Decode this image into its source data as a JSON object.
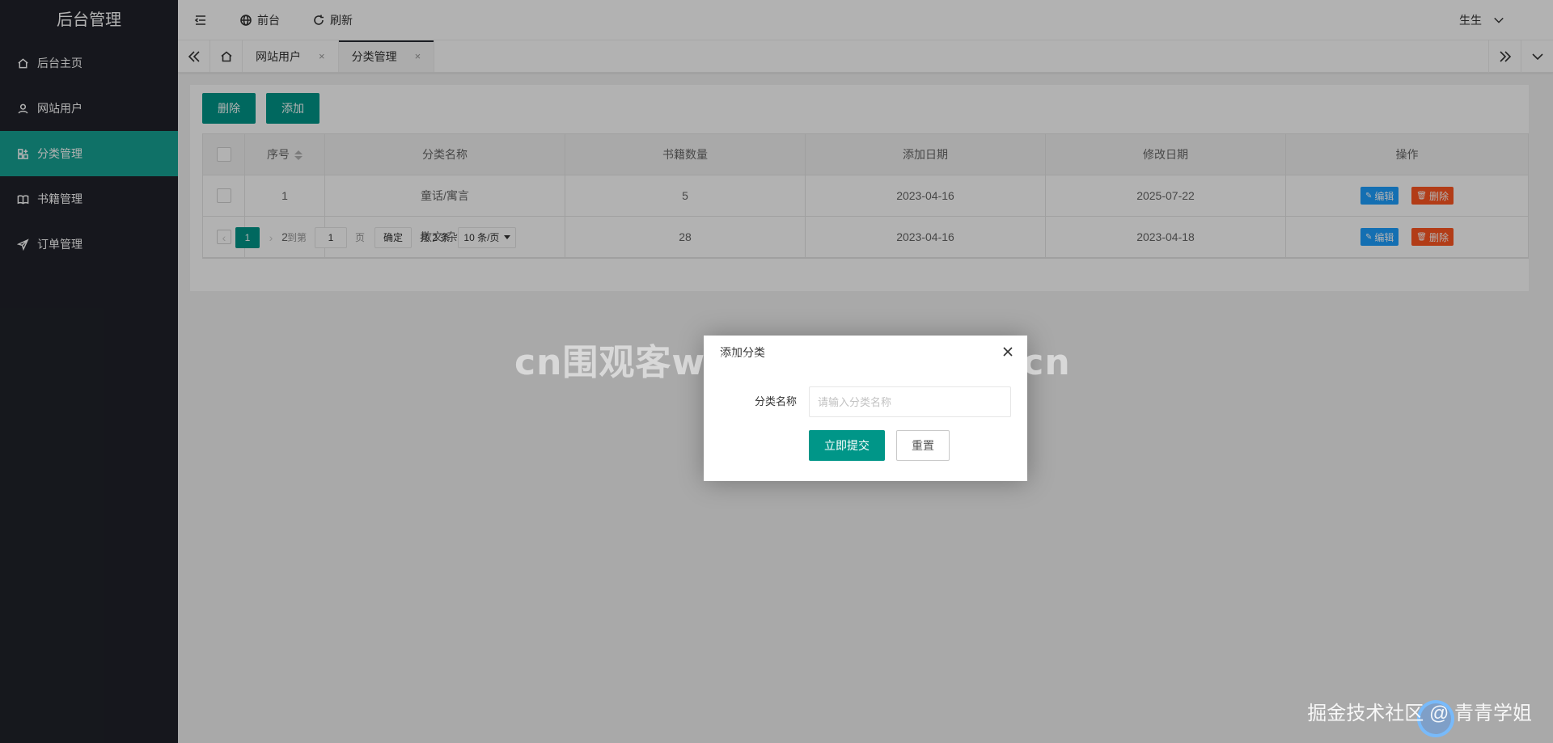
{
  "sidebar": {
    "logo": "后台管理",
    "items": [
      {
        "label": "后台主页",
        "icon": "home-icon",
        "active": false
      },
      {
        "label": "网站用户",
        "icon": "user-icon",
        "active": false
      },
      {
        "label": "分类管理",
        "icon": "apps-icon",
        "active": true
      },
      {
        "label": "书籍管理",
        "icon": "book-icon",
        "active": false
      },
      {
        "label": "订单管理",
        "icon": "send-icon",
        "active": false
      }
    ]
  },
  "header": {
    "frontend_label": "前台",
    "refresh_label": "刷新",
    "user_name": "生生"
  },
  "tabs": {
    "items": [
      {
        "label": "网站用户",
        "close": "×",
        "active": false
      },
      {
        "label": "分类管理",
        "close": "×",
        "active": true
      }
    ]
  },
  "toolbar": {
    "delete_label": "删除",
    "add_label": "添加"
  },
  "table": {
    "headers": [
      "序号",
      "分类名称",
      "书籍数量",
      "添加日期",
      "修改日期",
      "操作"
    ],
    "rows": [
      {
        "id": "1",
        "name": "童话/寓言",
        "count": "5",
        "added": "2023-04-16",
        "modified": "2025-07-22"
      },
      {
        "id": "2",
        "name": "散文/杂文",
        "count": "28",
        "added": "2023-04-16",
        "modified": "2023-04-18"
      }
    ],
    "edit_label": "编辑",
    "delete_label": "删除"
  },
  "pager": {
    "current": "1",
    "goto_label": "到第",
    "goto_value": "1",
    "page_label": "页",
    "confirm_label": "确定",
    "total_label": "共 2 条",
    "page_size": "10 条/页"
  },
  "dialog": {
    "title": "添加分类",
    "field_label": "分类名称",
    "field_placeholder": "请输入分类名称",
    "submit_label": "立即提交",
    "reset_label": "重置"
  },
  "watermarks": {
    "center": "cn围观客www.weiguanke.cn",
    "corner": "掘金技术社区 @ 青青学姐"
  },
  "colors": {
    "sidebar_bg": "#20222a",
    "active_nav": "#16a394",
    "primary": "#009688",
    "edit": "#1e9fff",
    "danger": "#ff5722"
  }
}
